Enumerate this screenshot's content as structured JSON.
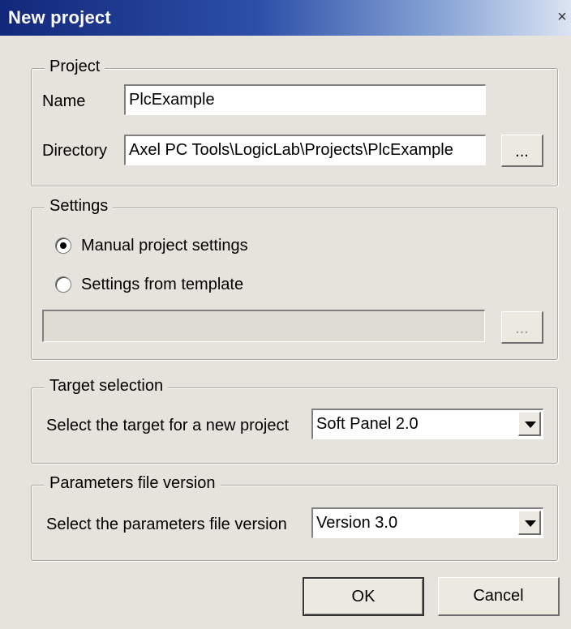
{
  "window": {
    "title": "New project",
    "close_glyph": "×"
  },
  "project": {
    "legend": "Project",
    "name_label": "Name",
    "name_value": "PlcExample",
    "directory_label": "Directory",
    "directory_value": "Axel PC Tools\\LogicLab\\Projects\\PlcExample",
    "browse_label": "..."
  },
  "settings": {
    "legend": "Settings",
    "manual_label": "Manual project settings",
    "template_label": "Settings from template",
    "template_value": "",
    "browse_label": "...",
    "selected": "manual"
  },
  "target": {
    "legend": "Target selection",
    "label": "Select the target for a new project",
    "selected": "Soft Panel 2.0"
  },
  "parameters": {
    "legend": "Parameters file version",
    "label": "Select the parameters file version",
    "selected": "Version 3.0"
  },
  "buttons": {
    "ok": "OK",
    "cancel": "Cancel"
  },
  "icons": {
    "close": "close-icon",
    "dropdown": "chevron-down-icon"
  }
}
